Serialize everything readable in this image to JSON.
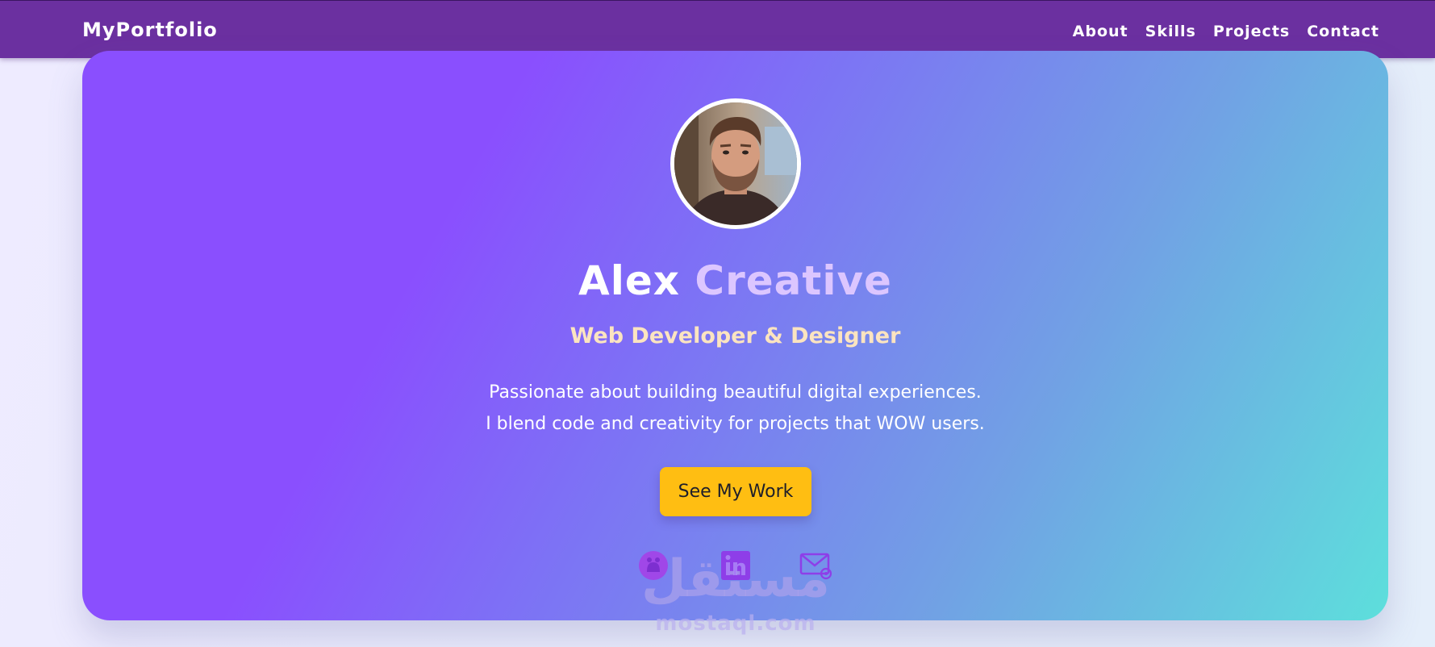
{
  "nav": {
    "brand": "MyPortfolio",
    "links": [
      "About",
      "Skills",
      "Projects",
      "Contact"
    ]
  },
  "hero": {
    "name_first": "Alex",
    "name_second": "Creative",
    "subtitle": "Web Developer & Designer",
    "description_line1": "Passionate about building beautiful digital experiences.",
    "description_line2": "I blend code and creativity for projects that WOW users.",
    "cta_label": "See My Work",
    "socials": [
      "github-icon",
      "linkedin-icon",
      "email-icon"
    ],
    "watermark_arabic": "مستقل",
    "watermark_latin": "mostaql.com"
  },
  "colors": {
    "nav_bg": "#6b30a0",
    "hero_gradient_start": "#8a4ffe",
    "hero_gradient_end": "#5ddfdc",
    "cta_bg": "#ffbe12",
    "subtitle": "#fbe4c0",
    "name_accent": "#dcc6ff"
  }
}
